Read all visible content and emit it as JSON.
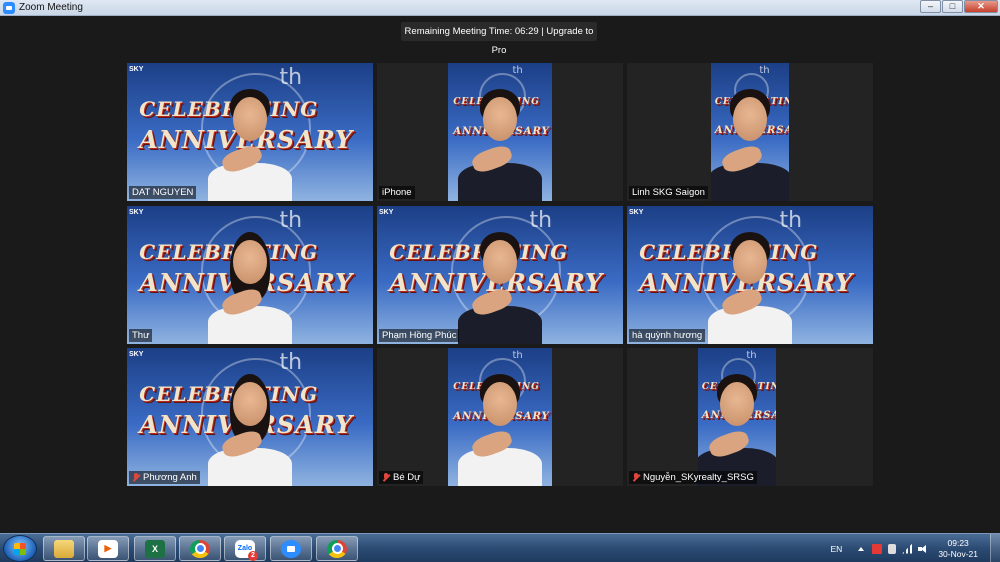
{
  "window": {
    "title": "Zoom Meeting",
    "controls": {
      "minimize": "–",
      "maximize": "□",
      "close": "✕"
    }
  },
  "meeting": {
    "banner": "Remaining Meeting Time: 06:29 | Upgrade to Pro",
    "background_text": {
      "line1": "CELEBRATING",
      "line2": "ANNIVERSARY",
      "ordinal": "th",
      "logo": "SKY"
    },
    "participants": [
      {
        "name": "DAT NGUYEN",
        "muted": false
      },
      {
        "name": "iPhone",
        "muted": false
      },
      {
        "name": "Linh SKG Saigon",
        "muted": false
      },
      {
        "name": "Thư",
        "muted": false
      },
      {
        "name": "Phạm Hồng Phúc",
        "muted": false
      },
      {
        "name": "hà quỳnh hương",
        "muted": false
      },
      {
        "name": "Phương Anh",
        "muted": true
      },
      {
        "name": "Bé Dự",
        "muted": true
      },
      {
        "name": "Nguyễn_SKyrealty_SRSG",
        "muted": true
      }
    ]
  },
  "taskbar": {
    "apps": [
      {
        "name": "explorer",
        "icon": "folder-icon"
      },
      {
        "name": "media",
        "icon": "media-player-icon"
      },
      {
        "name": "excel",
        "icon": "excel-icon"
      },
      {
        "name": "chrome",
        "icon": "chrome-icon"
      },
      {
        "name": "zalo",
        "icon": "zalo-icon",
        "label": "Zalo",
        "badge": "2"
      },
      {
        "name": "zoom",
        "icon": "zoom-icon"
      },
      {
        "name": "chrome-2",
        "icon": "chrome-icon"
      }
    ],
    "language": "EN",
    "time": "09:23",
    "date": "30-Nov-21"
  }
}
